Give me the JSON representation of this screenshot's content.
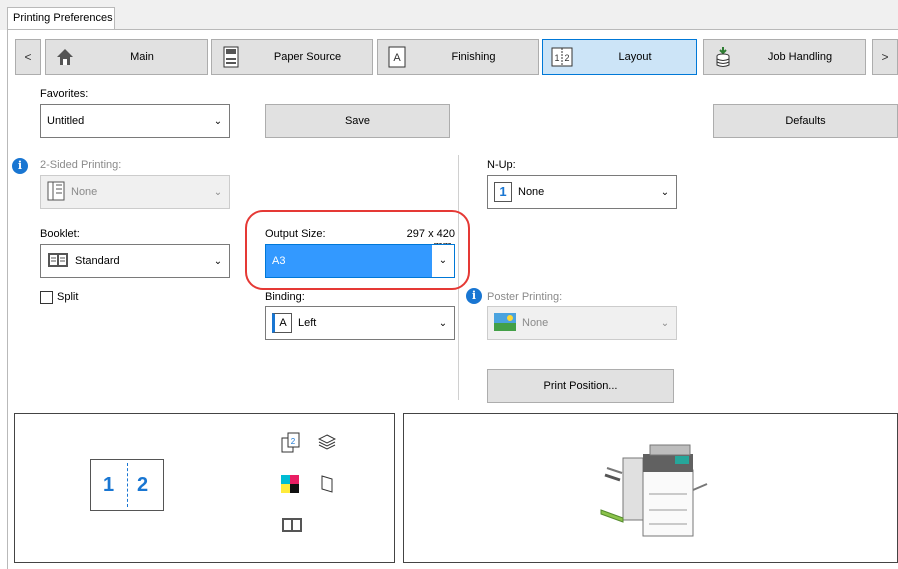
{
  "window": {
    "tab_title": "Printing Preferences"
  },
  "nav": {
    "prev": "<",
    "next": ">",
    "tabs": [
      {
        "label": "Main",
        "icon": "home-icon"
      },
      {
        "label": "Paper Source",
        "icon": "paper-source-icon"
      },
      {
        "label": "Finishing",
        "icon": "finishing-icon"
      },
      {
        "label": "Layout",
        "icon": "layout-icon",
        "active": true
      },
      {
        "label": "Job Handling",
        "icon": "job-handling-icon"
      }
    ]
  },
  "favorites": {
    "label": "Favorites:",
    "value": "Untitled",
    "save": "Save",
    "defaults": "Defaults"
  },
  "two_sided": {
    "label": "2-Sided Printing:",
    "value": "None"
  },
  "booklet": {
    "label": "Booklet:",
    "value": "Standard",
    "split_label": "Split",
    "split_checked": false
  },
  "output_size": {
    "label": "Output Size:",
    "size_text": "297 x 420 mm.",
    "value": "A3"
  },
  "binding": {
    "label": "Binding:",
    "value": "Left",
    "icon_letter": "A"
  },
  "nup": {
    "label": "N-Up:",
    "value": "None",
    "icon_digit": "1"
  },
  "poster": {
    "label": "Poster Printing:",
    "value": "None"
  },
  "print_position": {
    "label": "Print Position..."
  },
  "preview": {
    "page1": "1",
    "page2": "2"
  },
  "colors": {
    "accent": "#0078d7",
    "highlight": "#3399ff",
    "annotation": "#e53935"
  }
}
